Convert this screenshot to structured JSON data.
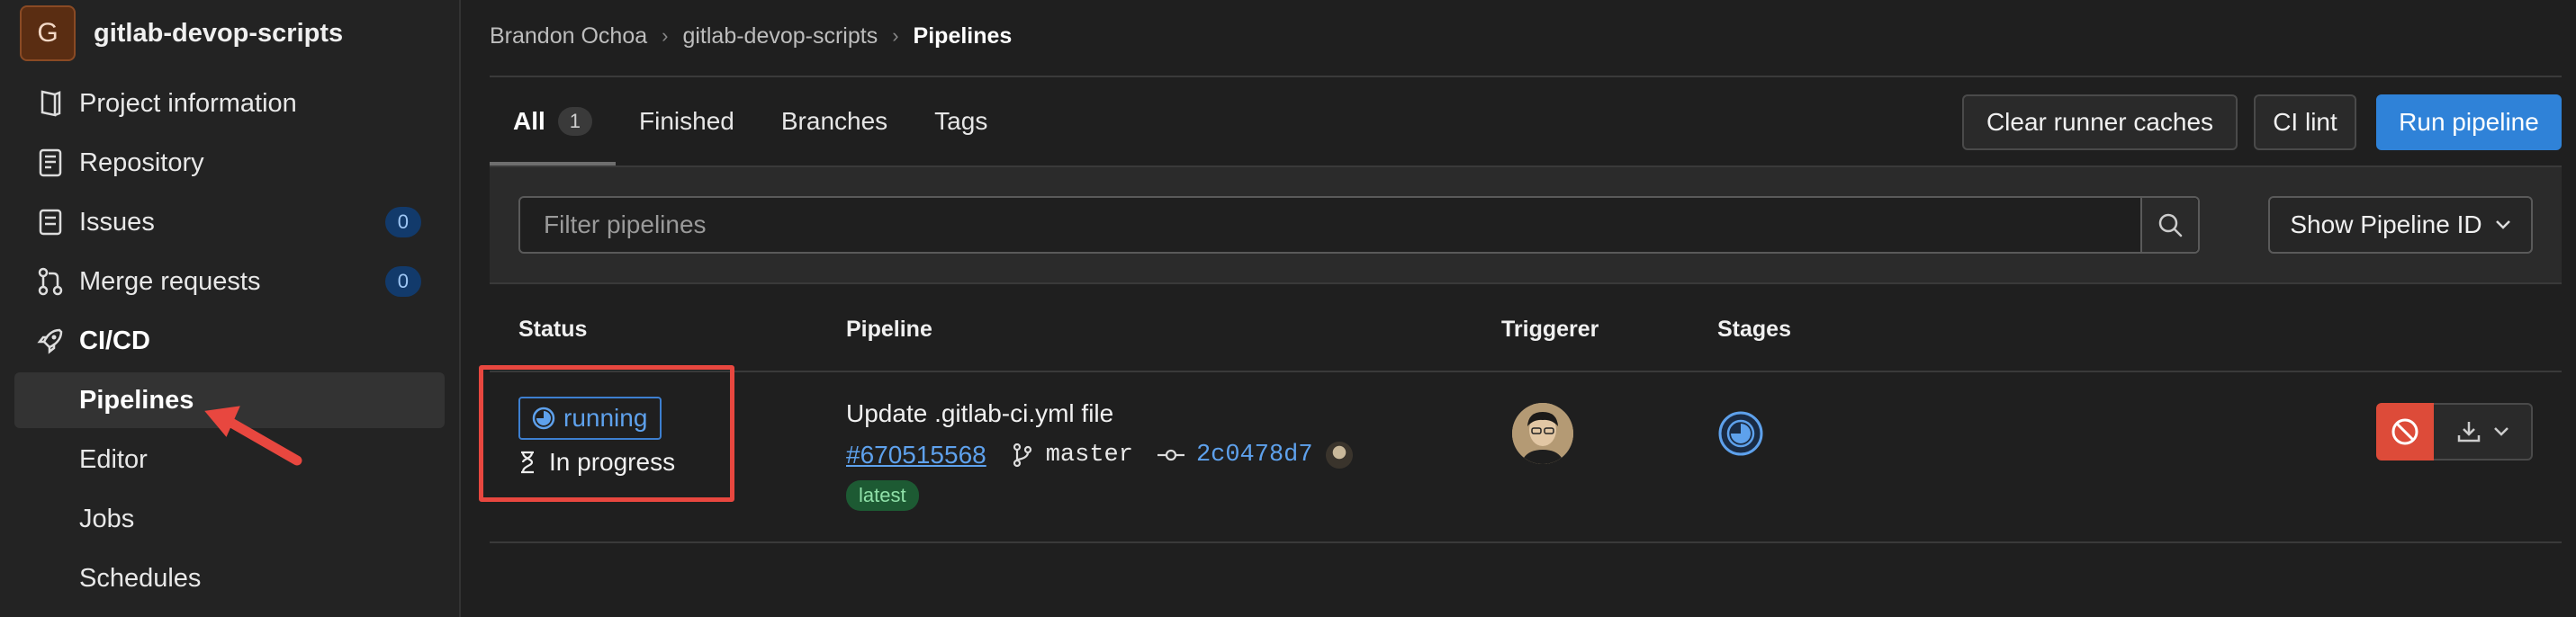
{
  "project": {
    "avatar_letter": "G",
    "name": "gitlab-devop-scripts"
  },
  "sidebar": {
    "items": [
      {
        "label": "Project information",
        "icon": "project-info-icon"
      },
      {
        "label": "Repository",
        "icon": "repository-icon"
      },
      {
        "label": "Issues",
        "icon": "issues-icon",
        "count": "0"
      },
      {
        "label": "Merge requests",
        "icon": "merge-request-icon",
        "count": "0"
      },
      {
        "label": "CI/CD",
        "icon": "rocket-icon"
      }
    ],
    "subitems": [
      {
        "label": "Pipelines",
        "active": true
      },
      {
        "label": "Editor"
      },
      {
        "label": "Jobs"
      },
      {
        "label": "Schedules"
      }
    ]
  },
  "breadcrumb": [
    "Brandon Ochoa",
    "gitlab-devop-scripts",
    "Pipelines"
  ],
  "tabs": [
    {
      "label": "All",
      "count": "1",
      "active": true
    },
    {
      "label": "Finished"
    },
    {
      "label": "Branches"
    },
    {
      "label": "Tags"
    }
  ],
  "actions": {
    "clear_caches": "Clear runner caches",
    "ci_lint": "CI lint",
    "run_pipeline": "Run pipeline"
  },
  "filter": {
    "placeholder": "Filter pipelines",
    "dropdown_label": "Show Pipeline ID"
  },
  "table": {
    "headers": {
      "status": "Status",
      "pipeline": "Pipeline",
      "triggerer": "Triggerer",
      "stages": "Stages"
    },
    "rows": [
      {
        "status": "running",
        "duration_text": "In progress",
        "title": "Update .gitlab-ci.yml file",
        "id": "#670515568",
        "branch": "master",
        "commit": "2c0478d7",
        "tag": "latest"
      }
    ]
  },
  "colors": {
    "accent_blue": "#2f82d8",
    "running_blue": "#5ea1ec",
    "danger_red": "#dd4b39",
    "annotation_red": "#e8473f",
    "latest_green": "#1d5a33"
  }
}
